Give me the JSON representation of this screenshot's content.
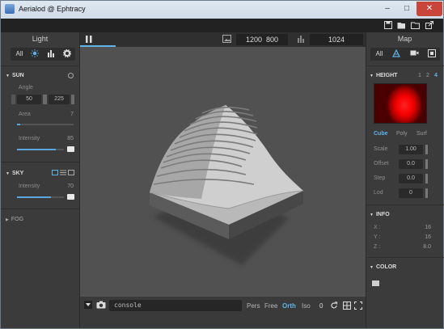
{
  "window": {
    "title": "Aerialod @ Ephtracy",
    "min": "–",
    "max": "□",
    "close": "✕"
  },
  "toolbar": {
    "save": "save-icon",
    "open": "open-icon",
    "folder": "folder-icon",
    "export": "export-icon"
  },
  "left_panel": {
    "title": "Light",
    "tabs": [
      {
        "label": "All"
      },
      {
        "icon": "sun-icon"
      },
      {
        "icon": "bars-icon"
      },
      {
        "icon": "gear-icon"
      }
    ],
    "sun": {
      "label": "SUN",
      "angle_label": "Angle",
      "angle_values": [
        "50",
        "225"
      ],
      "area_label": "Area",
      "area_value": "7",
      "area_fraction": 0.05,
      "intensity_label": "Intensity",
      "intensity_value": "85",
      "intensity_fraction": 0.82
    },
    "sky": {
      "label": "SKY",
      "intensity_label": "Intensity",
      "intensity_value": "70",
      "intensity_fraction": 0.72
    },
    "fog": {
      "label": "FOG"
    }
  },
  "top_bar": {
    "pause": "pause-icon",
    "width": "1200",
    "height": "800",
    "samples": "1024"
  },
  "right_panel": {
    "title": "Map",
    "tabs": [
      {
        "label": "All"
      },
      {
        "icon": "terrain-icon"
      },
      {
        "icon": "camera-icon"
      },
      {
        "icon": "box-icon"
      }
    ],
    "height": {
      "label": "HEIGHT",
      "pages": [
        "1",
        "2",
        "4"
      ],
      "active_page": "4",
      "modes": [
        "Cube",
        "Poly",
        "Surf"
      ],
      "active_mode": "Cube",
      "scale_label": "Scale",
      "scale_value": "1.00",
      "offset_label": "Offset",
      "offset_value": "0.0",
      "step_label": "Step",
      "step_value": "0.0",
      "lod_label": "Lod",
      "lod_value": "0"
    },
    "info": {
      "label": "INFO",
      "x_label": "X",
      "x": "16",
      "y_label": "Y",
      "y": "16",
      "z_label": "Z",
      "z": "8.0"
    },
    "color": {
      "label": "COLOR"
    }
  },
  "bottom_bar": {
    "console": "console",
    "modes": [
      "Pers",
      "Free",
      "Orth",
      "Iso"
    ],
    "active_mode": "Orth",
    "zero": "0"
  },
  "colors": {
    "accent": "#5fb4e8",
    "heightmap": "#ff0000"
  }
}
